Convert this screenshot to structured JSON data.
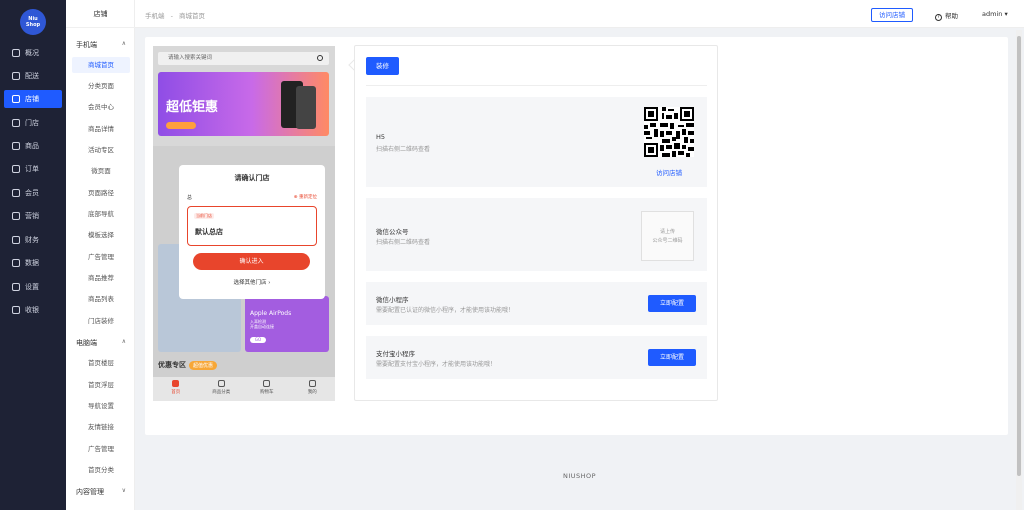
{
  "brand": {
    "logo_line1": "Niu",
    "logo_line2": "Shop"
  },
  "sidebar": {
    "items": [
      {
        "label": "概况",
        "icon": "dashboard-icon"
      },
      {
        "label": "配送",
        "icon": "delivery-icon"
      },
      {
        "label": "店铺",
        "icon": "store-icon",
        "active": true
      },
      {
        "label": "门店",
        "icon": "branch-icon"
      },
      {
        "label": "商品",
        "icon": "goods-icon"
      },
      {
        "label": "订单",
        "icon": "order-icon"
      },
      {
        "label": "会员",
        "icon": "member-icon"
      },
      {
        "label": "营销",
        "icon": "marketing-icon"
      },
      {
        "label": "财务",
        "icon": "finance-icon"
      },
      {
        "label": "数据",
        "icon": "data-icon"
      },
      {
        "label": "设置",
        "icon": "settings-icon"
      },
      {
        "label": "收银",
        "icon": "cashier-icon"
      }
    ]
  },
  "subnav": {
    "title": "店铺",
    "group_mobile": "手机端",
    "mobile_items": [
      "商城首页",
      "分类页面",
      "会员中心",
      "商品详情",
      "活动专区",
      "微页面",
      "页面路径",
      "底部导航",
      "模板选择",
      "广告管理",
      "商品推荐",
      "商品列表",
      "门店装修"
    ],
    "group_pc": "电脑端",
    "pc_items": [
      "首页楼层",
      "首页浮层",
      "导航设置",
      "友情链接",
      "广告管理",
      "首页分类"
    ],
    "group_content": "内容管理"
  },
  "topbar": {
    "crumb_1": "手机端",
    "crumb_sep": "-",
    "crumb_2": "商城首页",
    "visit_store": "访问店铺",
    "help": "帮助",
    "user": "admin"
  },
  "phone": {
    "search_placeholder": "请输入搜索关键词",
    "banner_title": "超低钜惠",
    "promo_b_title": "Apple AirPods",
    "promo_b_sub1": "入耳检测",
    "promo_b_sub2": "开盖自动连接",
    "promo_b_btn": "GO",
    "sale_title": "优惠专区",
    "sale_badge": "超值优惠",
    "tabs": [
      "首页",
      "商品分类",
      "购物车",
      "我的"
    ]
  },
  "modal": {
    "title": "请确认门店",
    "location": "总",
    "relocate": "重新定位",
    "card_tag": "当前门店",
    "store_name": "默认总店",
    "confirm": "确认进入",
    "other": "选择其他门店"
  },
  "panel": {
    "decor_button": "装修",
    "h5_title": "H5",
    "h5_desc": "扫描右侧二维码查看",
    "h5_link": "访问店铺",
    "wechat_title": "微信公众号",
    "wechat_desc": "扫描右侧二维码查看",
    "wechat_upload_1": "请上传",
    "wechat_upload_2": "公众号二维码",
    "mini_title": "微信小程序",
    "mini_desc": "需要配置已认证的微信小程序，才能使用该功能哦！",
    "mini_button": "立即配置",
    "alipay_title": "支付宝小程序",
    "alipay_desc": "需要配置支付宝小程序，才能使用该功能哦！",
    "alipay_button": "立即配置"
  },
  "footer": {
    "text": "NIUSHOP"
  },
  "colors": {
    "primary": "#1f5bff",
    "danger": "#e8452c",
    "sidebar_bg": "#1e2235"
  }
}
